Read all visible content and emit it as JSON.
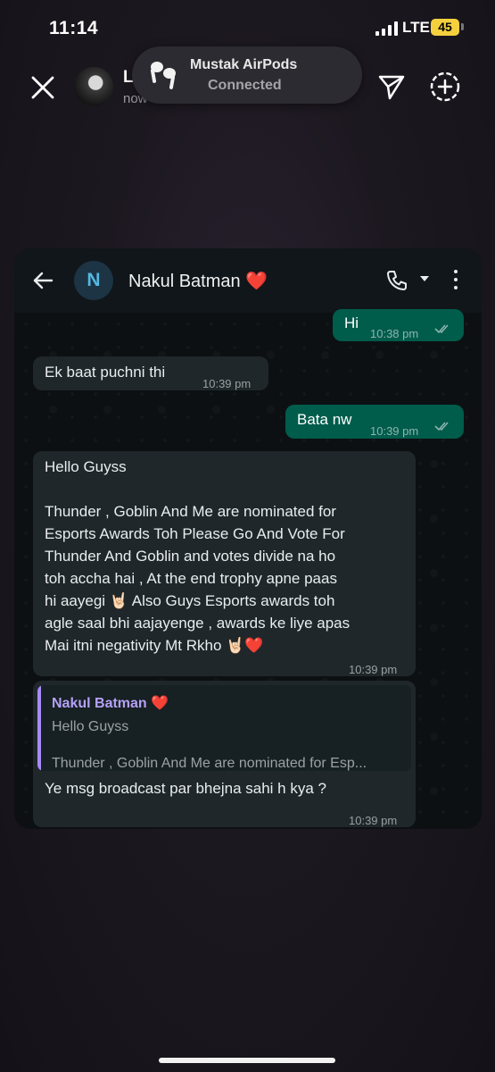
{
  "status_bar": {
    "time": "11:14",
    "network": "LTE",
    "battery": "45"
  },
  "story": {
    "name": "L",
    "subtitle": "now"
  },
  "notification": {
    "title": "Mustak AirPods",
    "status": "Connected"
  },
  "chat": {
    "contact_initial": "N",
    "contact_name": "Nakul Batman",
    "contact_heart": "❤️",
    "messages": [
      {
        "direction": "outgoing",
        "text": "Hi",
        "time": "10:38 pm",
        "read": true
      },
      {
        "direction": "incoming",
        "text": "Ek baat puchni thi",
        "time": "10:39 pm"
      },
      {
        "direction": "outgoing",
        "text": "Bata nw",
        "time": "10:39 pm",
        "read": true
      },
      {
        "direction": "incoming",
        "lines": [
          "Hello Guyss",
          "",
          "Thunder , Goblin And Me are nominated for",
          "Esports Awards Toh Please Go And Vote For",
          "Thunder And Goblin and votes divide na ho",
          "toh accha hai , At the end trophy apne paas",
          "hi aayegi 🤘🏻 Also Guys Esports awards toh",
          "agle saal bhi aajayenge , awards ke liye apas",
          "Mai itni negativity Mt Rkho 🤘🏻❤️"
        ],
        "time": "10:39 pm"
      },
      {
        "direction": "incoming",
        "quote": {
          "author": "Nakul Batman ❤️",
          "line1": "Hello Guyss",
          "line2": "Thunder , Goblin And Me are nominated for Esp..."
        },
        "text": "Ye msg broadcast par bhejna sahi h kya ?",
        "time": "10:39 pm"
      }
    ]
  },
  "colors": {
    "outgoing_bubble": "#005c4b",
    "incoming_bubble": "#1f272a",
    "quote_bar": "#a78bfa",
    "battery": "#f4d03f"
  }
}
